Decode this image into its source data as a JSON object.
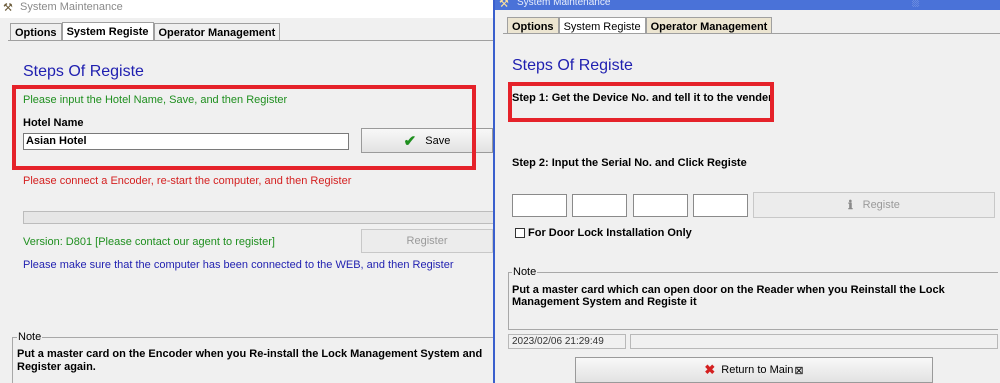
{
  "left_window": {
    "title": "System Maintenance",
    "tabs": [
      {
        "label": "Options"
      },
      {
        "label": "System Registe"
      },
      {
        "label": "Operator Management"
      }
    ],
    "heading": "Steps Of Registe",
    "instruction": "Please input the Hotel Name, Save, and then Register",
    "hotel_name_label": "Hotel Name",
    "hotel_name_value": "Asian Hotel",
    "save_label": "Save",
    "encoder_notice": "Please connect a Encoder, re-start the computer, and then Register",
    "version_text": "Version: D801   [Please contact our agent to register]",
    "register_label": "Register",
    "web_notice": "Please make sure that the computer has been connected to the WEB, and then Register",
    "note_label": "Note",
    "note_text": "Put a master card on the Encoder when you Re-install the Lock Management System and Register again."
  },
  "right_window": {
    "title": "System Maintenance",
    "tabs": [
      {
        "label": "Options"
      },
      {
        "label": "System Registe"
      },
      {
        "label": "Operator Management"
      }
    ],
    "heading": "Steps Of Registe",
    "step1": "Step 1: Get the Device No. and tell it to the vender",
    "step2": "Step 2: Input the Serial No. and Click Registe",
    "registe_label": "Registe",
    "door_lock_checkbox_label": "For Door Lock Installation Only",
    "note_label": "Note",
    "note_text": "Put a master card which can open door on the Reader when you Reinstall the Lock Management System and Registe it",
    "status_timestamp": "2023/02/06 21:29:49",
    "return_label": "Return to Main"
  },
  "colors": {
    "heading": "#1f1fb0",
    "green_text": "#1f8f1f",
    "red_text": "#d42020",
    "highlight_box": "#e5222a",
    "titlebar_right": "#4a72d8"
  },
  "icons": {
    "save": "check-icon",
    "registe": "info-icon",
    "return": "x-icon"
  }
}
